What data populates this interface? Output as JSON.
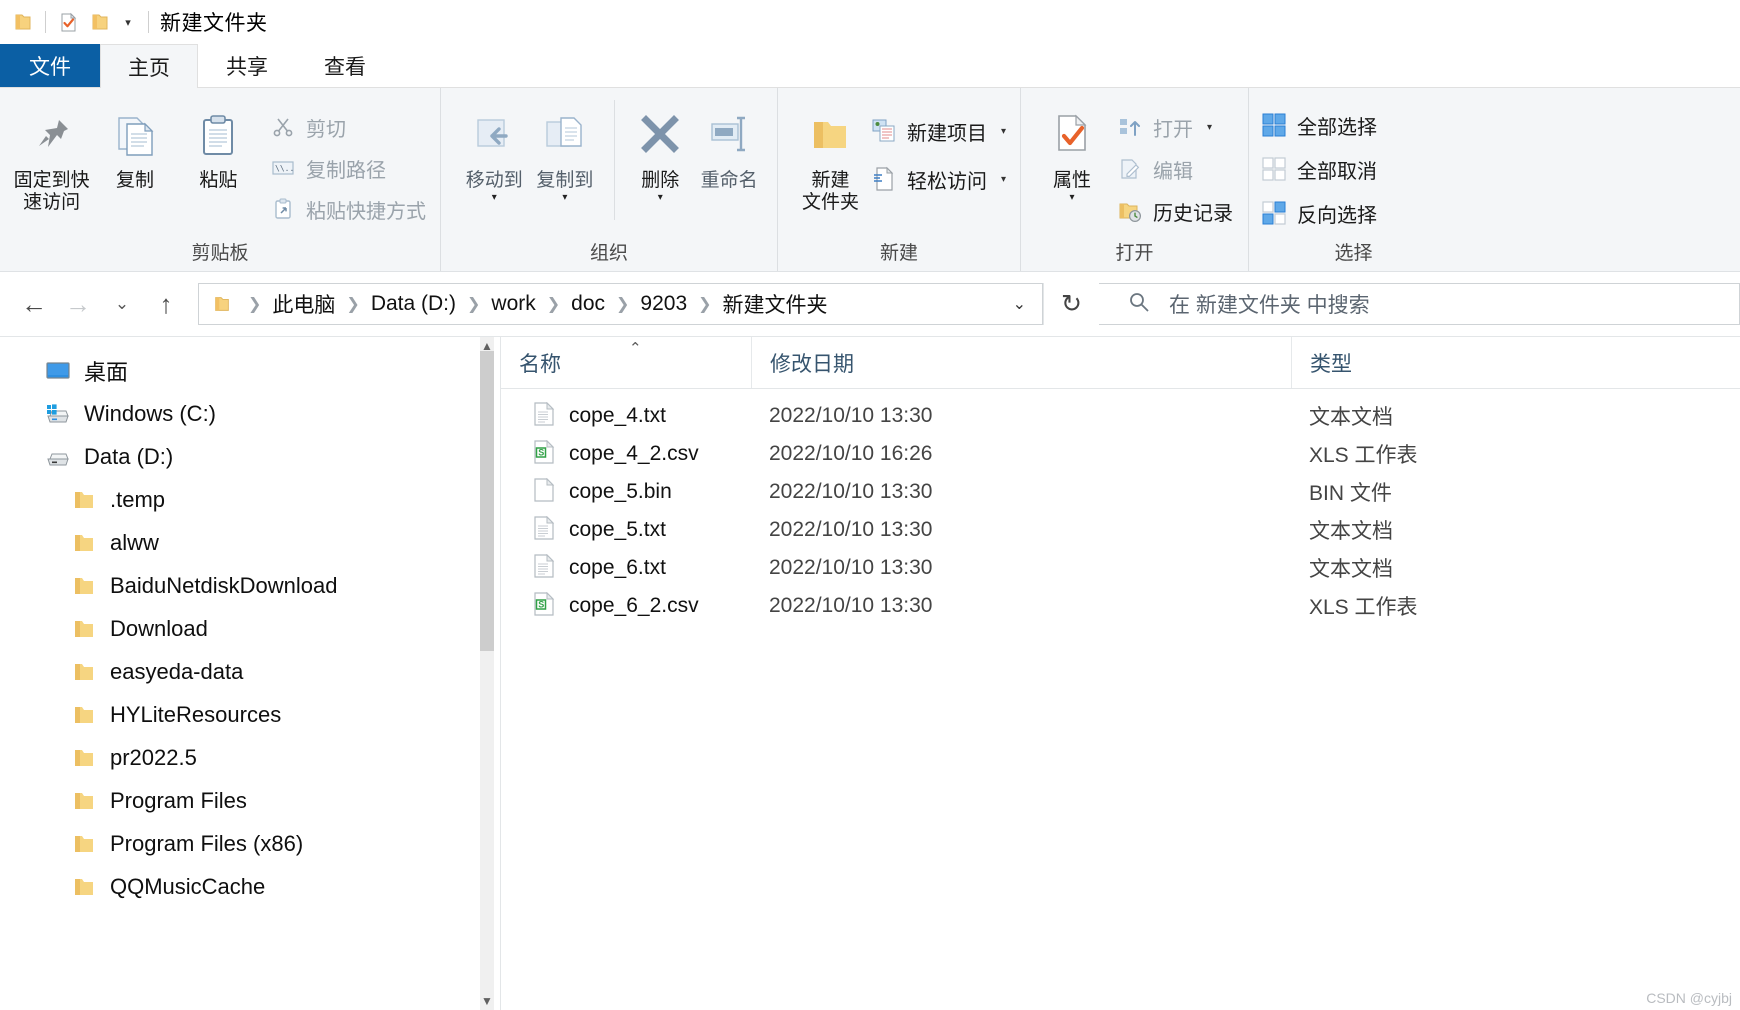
{
  "window": {
    "title": "新建文件夹",
    "quick_access_icons": [
      "folder-icon",
      "properties-check-icon",
      "new-folder-icon"
    ],
    "customize_caret": "▾"
  },
  "tabs": [
    {
      "id": "file",
      "label": "文件"
    },
    {
      "id": "home",
      "label": "主页"
    },
    {
      "id": "share",
      "label": "共享"
    },
    {
      "id": "view",
      "label": "查看"
    }
  ],
  "ribbon": {
    "groups": [
      {
        "id": "clipboard",
        "label": "剪贴板",
        "big": [
          {
            "id": "pin-to-quick-access",
            "label": "固定到快\n速访问",
            "icon": "pin-icon"
          },
          {
            "id": "copy",
            "label": "复制",
            "icon": "copy-icon"
          },
          {
            "id": "paste",
            "label": "粘贴",
            "icon": "paste-icon"
          }
        ],
        "small": [
          {
            "id": "cut",
            "label": "剪切",
            "icon": "scissors-icon",
            "disabled": true
          },
          {
            "id": "copy-path",
            "label": "复制路径",
            "icon": "copy-path-icon",
            "disabled": true
          },
          {
            "id": "paste-shortcut",
            "label": "粘贴快捷方式",
            "icon": "paste-shortcut-icon",
            "disabled": true
          }
        ]
      },
      {
        "id": "organize",
        "label": "组织",
        "big": [
          {
            "id": "move-to",
            "label": "移动到",
            "icon": "move-to-icon",
            "caret": "▾",
            "disabled": true
          },
          {
            "id": "copy-to",
            "label": "复制到",
            "icon": "copy-to-icon",
            "caret": "▾",
            "disabled": true
          },
          {
            "id": "delete",
            "label": "删除",
            "icon": "delete-x-icon",
            "caret": "▾"
          },
          {
            "id": "rename",
            "label": "重命名",
            "icon": "rename-icon",
            "disabled": true
          }
        ],
        "small": []
      },
      {
        "id": "new",
        "label": "新建",
        "big": [
          {
            "id": "new-folder",
            "label": "新建\n文件夹",
            "icon": "new-folder-icon"
          }
        ],
        "small": [
          {
            "id": "new-item",
            "label": "新建项目",
            "icon": "new-item-icon",
            "caret": "▾"
          },
          {
            "id": "easy-access",
            "label": "轻松访问",
            "icon": "easy-access-icon",
            "caret": "▾"
          }
        ]
      },
      {
        "id": "open",
        "label": "打开",
        "big": [
          {
            "id": "properties",
            "label": "属性",
            "icon": "properties-check-icon",
            "caret": "▾"
          }
        ],
        "small": [
          {
            "id": "open",
            "label": "打开",
            "icon": "open-icon",
            "caret": "▾",
            "disabled": true
          },
          {
            "id": "edit",
            "label": "编辑",
            "icon": "edit-icon",
            "disabled": true
          },
          {
            "id": "history",
            "label": "历史记录",
            "icon": "history-icon"
          }
        ]
      },
      {
        "id": "select",
        "label": "选择",
        "big": [],
        "small": [
          {
            "id": "select-all",
            "label": "全部选择",
            "icon": "select-all-icon"
          },
          {
            "id": "select-none",
            "label": "全部取消",
            "icon": "select-none-icon"
          },
          {
            "id": "invert-selection",
            "label": "反向选择",
            "icon": "invert-selection-icon"
          }
        ]
      }
    ]
  },
  "addressbar": {
    "back_glyph": "←",
    "forward_glyph": "→",
    "recent_glyph": "⌄",
    "up_glyph": "↑",
    "folder_icon": "folder-icon",
    "crumbs": [
      "此电脑",
      "Data (D:)",
      "work",
      "doc",
      "9203",
      "新建文件夹"
    ],
    "separator": "❯",
    "dropdown_glyph": "⌄",
    "refresh_glyph": "↻"
  },
  "search": {
    "icon": "search-icon",
    "placeholder": "在 新建文件夹 中搜索"
  },
  "navpane": {
    "items": [
      {
        "id": "desktop",
        "label": "桌面",
        "icon": "desktop-icon",
        "indent": false
      },
      {
        "id": "windows-c",
        "label": "Windows (C:)",
        "icon": "windows-drive-icon",
        "indent": false
      },
      {
        "id": "data-d",
        "label": "Data (D:)",
        "icon": "drive-icon",
        "indent": false
      },
      {
        "id": "temp",
        "label": ".temp",
        "icon": "folder-icon",
        "indent": true
      },
      {
        "id": "alww",
        "label": "alww",
        "icon": "folder-icon",
        "indent": true
      },
      {
        "id": "baidunetdiskdownload",
        "label": "BaiduNetdiskDownload",
        "icon": "folder-icon",
        "indent": true
      },
      {
        "id": "download",
        "label": "Download",
        "icon": "folder-icon",
        "indent": true
      },
      {
        "id": "easyeda-data",
        "label": "easyeda-data",
        "icon": "folder-icon",
        "indent": true
      },
      {
        "id": "hyliteresources",
        "label": "HYLiteResources",
        "icon": "folder-icon",
        "indent": true
      },
      {
        "id": "pr2022-5",
        "label": "pr2022.5",
        "icon": "folder-icon",
        "indent": true
      },
      {
        "id": "program-files",
        "label": "Program Files",
        "icon": "folder-icon",
        "indent": true
      },
      {
        "id": "program-files-x86",
        "label": "Program Files (x86)",
        "icon": "folder-icon",
        "indent": true
      },
      {
        "id": "qqmusiccache",
        "label": "QQMusicCache",
        "icon": "folder-icon",
        "indent": true
      }
    ]
  },
  "filelist": {
    "columns": {
      "name": "名称",
      "date": "修改日期",
      "type": "类型"
    },
    "sort_indicator": "⌃",
    "rows": [
      {
        "name": "cope_4.txt",
        "date": "2022/10/10 13:30",
        "type": "文本文档",
        "icon": "text-file-icon"
      },
      {
        "name": "cope_4_2.csv",
        "date": "2022/10/10 16:26",
        "type": "XLS 工作表",
        "icon": "csv-file-icon"
      },
      {
        "name": "cope_5.bin",
        "date": "2022/10/10 13:30",
        "type": "BIN 文件",
        "icon": "blank-file-icon"
      },
      {
        "name": "cope_5.txt",
        "date": "2022/10/10 13:30",
        "type": "文本文档",
        "icon": "text-file-icon"
      },
      {
        "name": "cope_6.txt",
        "date": "2022/10/10 13:30",
        "type": "文本文档",
        "icon": "text-file-icon"
      },
      {
        "name": "cope_6_2.csv",
        "date": "2022/10/10 13:30",
        "type": "XLS 工作表",
        "icon": "csv-file-icon"
      }
    ]
  },
  "watermark": "CSDN @cyjbj",
  "colors": {
    "file_tab_blue": "#0b5fa4",
    "ribbon_bg": "#f4f6f8",
    "folder_yellow": "#f6d581",
    "accent_orange": "#e8622a",
    "csv_green": "#31a147",
    "header_text": "#36546e"
  }
}
